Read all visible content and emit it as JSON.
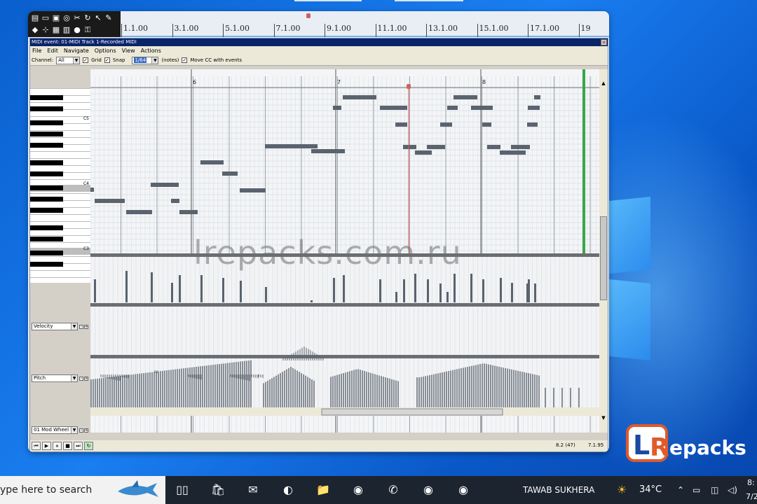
{
  "toolbar": {
    "icons": [
      "open-icon",
      "folder-icon",
      "save-icon",
      "metronome-icon",
      "cut-icon",
      "loop-icon",
      "arrow-icon",
      "pencil-icon",
      "eraser-icon",
      "grid-icon",
      "mixer-icon",
      "lock-icon",
      "select-icon",
      "record-icon"
    ]
  },
  "ruler": {
    "marks": [
      "1.1.00",
      "3.1.00",
      "5.1.00",
      "7.1.00",
      "9.1.00",
      "11.1.00",
      "13.1.00",
      "15.1.00",
      "17.1.00",
      "19"
    ]
  },
  "window": {
    "title": "MIDI event: 01-MIDI Track 1-Recorded MIDI",
    "close": "✕"
  },
  "menu": [
    "File",
    "Edit",
    "Navigate",
    "Options",
    "View",
    "Actions"
  ],
  "options": {
    "channel_label": "Channel:",
    "channel_value": "All",
    "grid_label": "Grid",
    "snap_label": "Snap",
    "snap_value": "1/64",
    "notes_label": "(notes)",
    "movecc_label": "Move CC with events"
  },
  "piano": {
    "octaves": [
      "C5",
      "C4",
      "C3"
    ]
  },
  "measures": [
    "6",
    "7",
    "8"
  ],
  "lanes": {
    "velocity": "Velocity",
    "pitch": "Pitch",
    "mod": "01 Mod Wheel M"
  },
  "status": {
    "position": "8.2 (47)",
    "time": "7.1.95"
  },
  "watermark": "lrepacks.com.ru",
  "logo": {
    "text": "Repacks",
    "letter": "L"
  },
  "taskbar": {
    "search": "ype here to search",
    "user": "TAWAB SUKHERA",
    "temp": "34°C",
    "clock1": "8:",
    "clock2": "7/2"
  },
  "colors": {
    "note": "#5a636e",
    "grid_bg": "#ffffff",
    "playhead": "#3aa64a",
    "title_bar": "#0a246a"
  }
}
